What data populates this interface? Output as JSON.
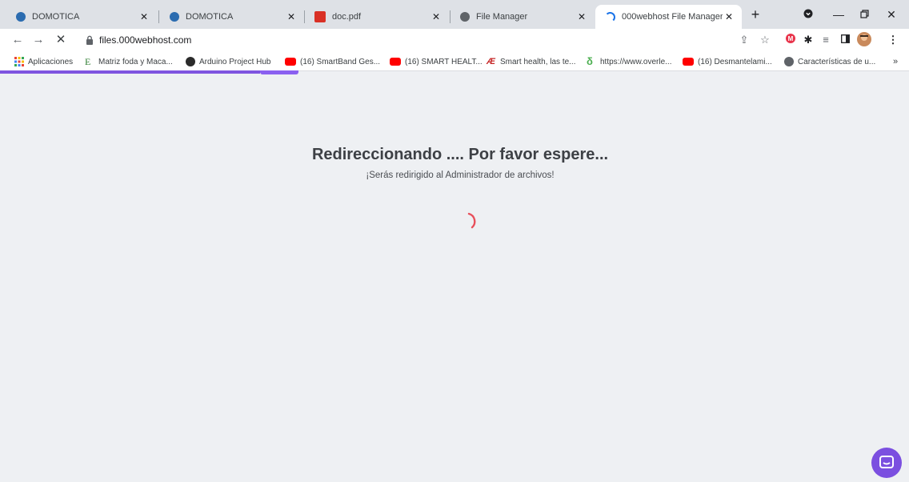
{
  "tabs": [
    {
      "label": "DOMOTICA",
      "icon": "web-app-icon"
    },
    {
      "label": "DOMOTICA",
      "icon": "web-app-icon"
    },
    {
      "label": "doc.pdf",
      "icon": "pdf-icon"
    },
    {
      "label": "File Manager",
      "icon": "globe-icon"
    },
    {
      "label": "000webhost File Manager",
      "icon": "loading-icon",
      "active": true
    }
  ],
  "address_bar": {
    "url": "files.000webhost.com"
  },
  "bookmarks": [
    {
      "label": "Aplicaciones",
      "icon": "apps-grid-icon"
    },
    {
      "label": "Matriz foda y Maca...",
      "icon": "e-logo-icon"
    },
    {
      "label": "Arduino Project Hub",
      "icon": "arduino-icon"
    },
    {
      "label": "(16) SmartBand Ges...",
      "icon": "youtube-icon"
    },
    {
      "label": "(16) SMART HEALT...",
      "icon": "youtube-icon"
    },
    {
      "label": "Smart health, las te...",
      "icon": "site-logo-icon"
    },
    {
      "label": "https://www.overle...",
      "icon": "overleaf-icon"
    },
    {
      "label": "(16) Desmantelami...",
      "icon": "youtube-icon"
    },
    {
      "label": "Características de u...",
      "icon": "globe-icon"
    }
  ],
  "page": {
    "title": "Redireccionando .... Por favor espere...",
    "subtitle": "¡Serás redirigido al Administrador de archivos!"
  },
  "colors": {
    "accent": "#7b4fe0",
    "spinner": "#e8505b",
    "background": "#eef0f3"
  }
}
